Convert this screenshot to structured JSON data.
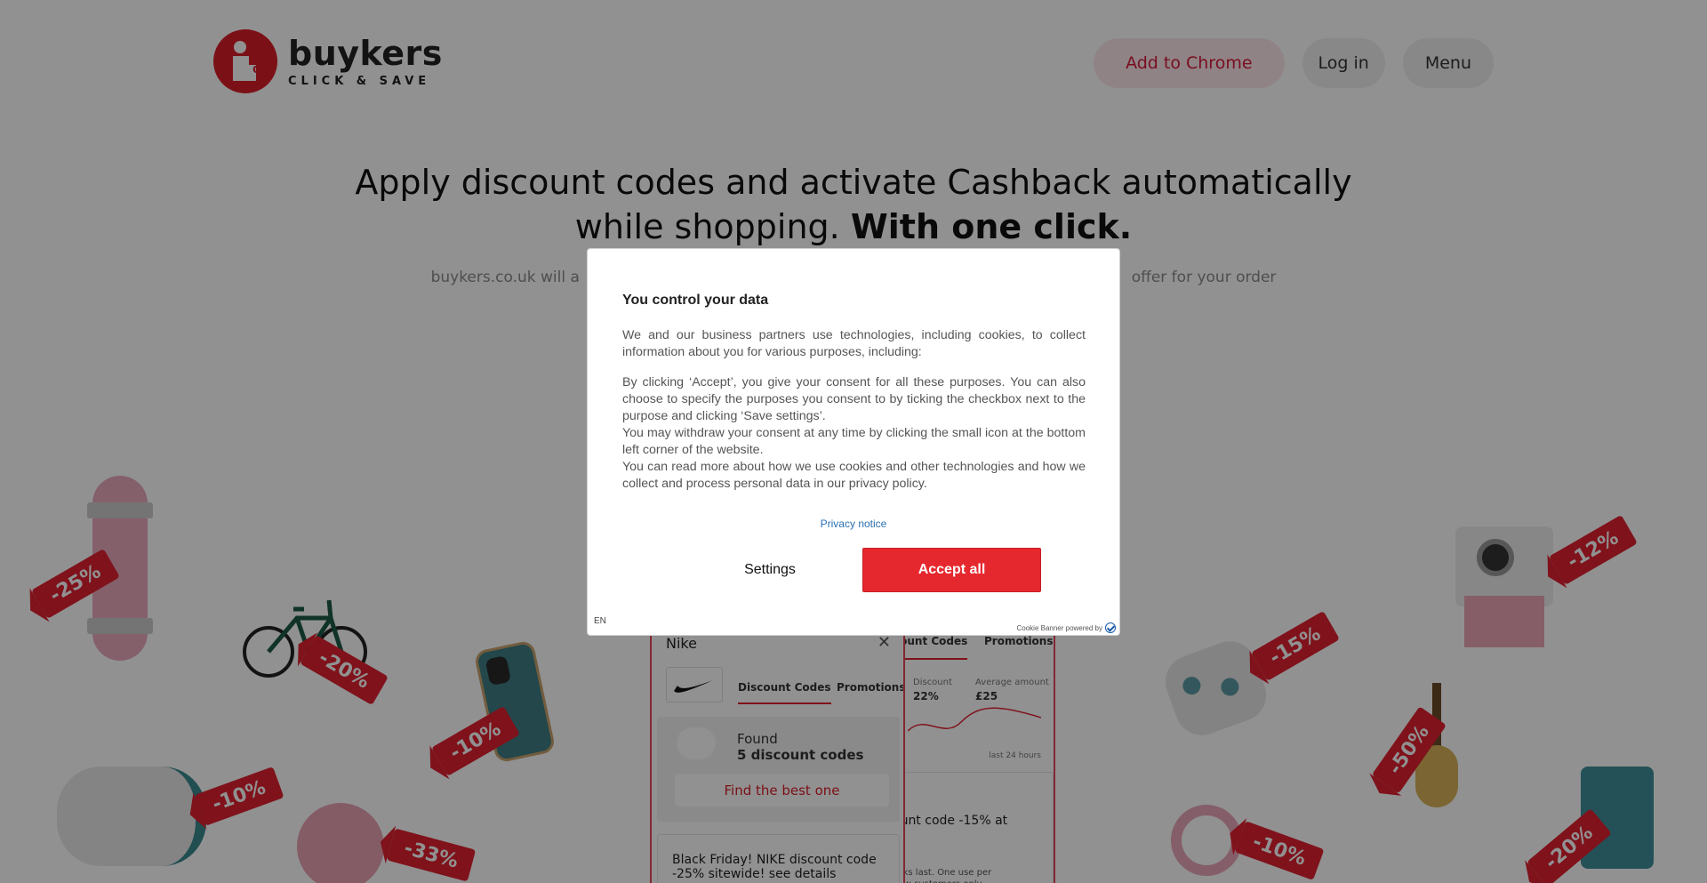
{
  "brand": {
    "name": "buykers",
    "tagline": "CLICK & SAVE",
    "color": "#d81e2a"
  },
  "nav": {
    "add_to_chrome": "Add to Chrome",
    "login": "Log in",
    "menu": "Menu"
  },
  "hero": {
    "title_line1": "Apply discount codes and activate Cashback automatically",
    "title_line2_prefix": "while shopping.",
    "title_line2_bold": "With one click.",
    "sub_left": "buykers.co.uk will a",
    "sub_right": "offer for your order"
  },
  "deco_tags": [
    "-25%",
    "-20%",
    "-10%",
    "-10%",
    "-33%",
    "-12%",
    "-15%",
    "-50%",
    "-10%",
    "-20%"
  ],
  "mock_front": {
    "brand": "Nike",
    "close": "✕",
    "tab_codes": "Discount Codes",
    "tab_promotions": "Promotions",
    "found_label": "Found",
    "found_count": "5 discount codes",
    "find_best": "Find the best one",
    "deal_text": "Black Friday! NIKE discount code -25% sitewide! see details"
  },
  "mock_back": {
    "tab_codes": "count Codes",
    "tab_promotions": "Promotions",
    "discount_label": "Discount",
    "discount_value": "22%",
    "avg_label": "Average amount",
    "avg_value": "£25",
    "last_label": "last 24 hours",
    "card_text": "ount code -15% at",
    "card_small": "ocks last. One use per new customers only"
  },
  "modal": {
    "title": "You control your data",
    "p1": "We and our business partners use technologies, including cookies, to collect information about you for various purposes, including:",
    "p2": "By clicking ‘Accept’, you give your consent for all these purposes. You can also choose to specify the purposes you consent to by ticking the checkbox next to the purpose and clicking ‘Save settings’.",
    "p3": "You may withdraw your consent at any time by clicking the small icon at the bottom left corner of the website.",
    "p4": "You can read more about how we use cookies and other technologies and how we collect and process personal data in our privacy policy.",
    "privacy_link": "Privacy notice",
    "settings_label": "Settings",
    "accept_label": "Accept all",
    "lang": "EN",
    "powered_by": "Cookie Banner powered by",
    "accent": "#e5282e"
  }
}
